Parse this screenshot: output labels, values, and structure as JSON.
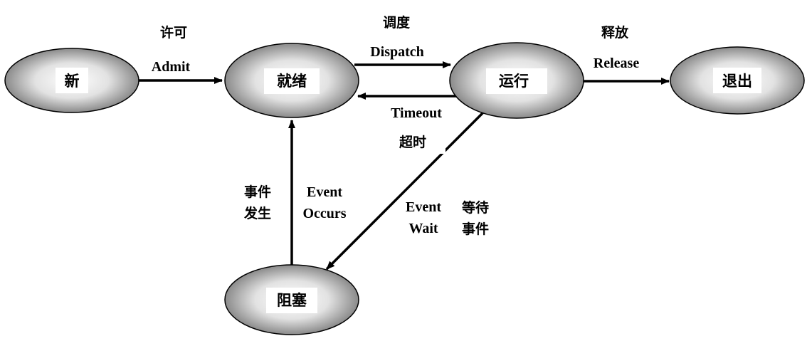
{
  "colors": {
    "node_fill_light": "#ffffff",
    "node_fill_dark": "#8a8a8a",
    "node_outline": "#000000",
    "label_box": "#ffffff",
    "edge": "#000000"
  },
  "states": {
    "new": "新",
    "ready": "就绪",
    "running": "运行",
    "exit": "退出",
    "blocked": "阻塞"
  },
  "transitions": {
    "admit": {
      "zh": "许可",
      "en": "Admit"
    },
    "dispatch": {
      "zh": "调度",
      "en": "Dispatch"
    },
    "release": {
      "zh": "释放",
      "en": "Release"
    },
    "timeout": {
      "zh": "超时",
      "en": "Timeout"
    },
    "event_occurs": {
      "zh_line1": "事件",
      "zh_line2": "发生",
      "en_line1": "Event",
      "en_line2": "Occurs"
    },
    "event_wait": {
      "zh_line1": "等待",
      "zh_line2": "事件",
      "en_line1": "Event",
      "en_line2": "Wait"
    }
  }
}
